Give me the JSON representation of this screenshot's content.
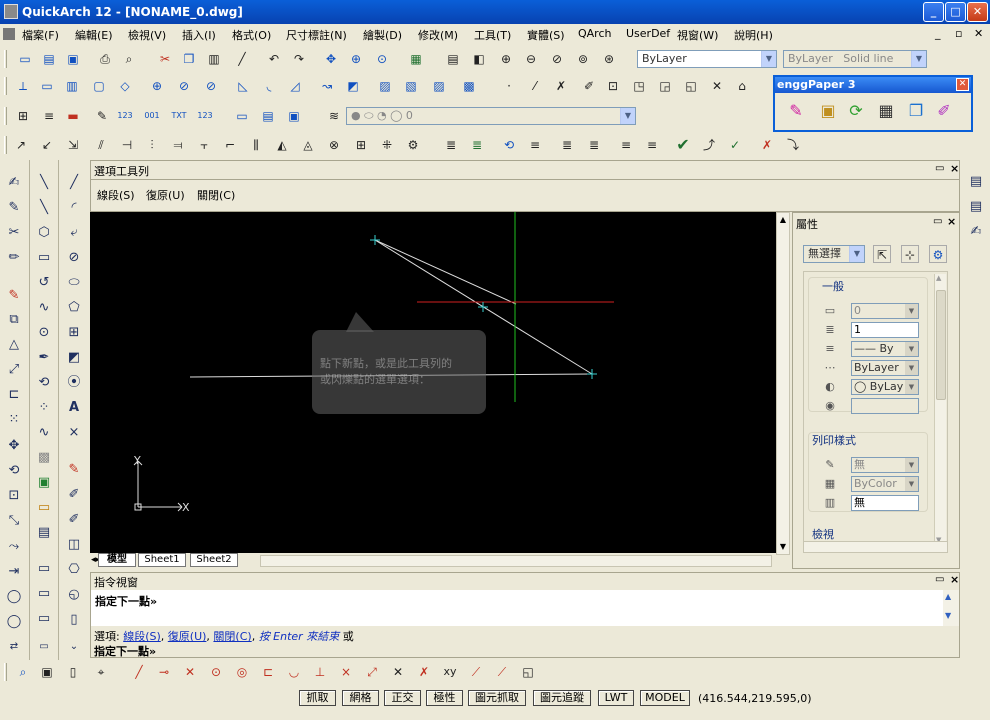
{
  "window": {
    "title": "QuickArch 12 - [NONAME_0.dwg]",
    "min_label": "_",
    "max_label": "□",
    "close_label": "✕",
    "doc_min": "_",
    "doc_max": "▫",
    "doc_close": "✕"
  },
  "menu": [
    "檔案(F)",
    "編輯(E)",
    "檢視(V)",
    "插入(I)",
    "格式(O)",
    "尺寸標註(N)",
    "繪製(D)",
    "修改(M)",
    "工具(T)",
    "實體(S)",
    "QArch",
    "UserDef",
    "視窗(W)",
    "說明(H)"
  ],
  "toolbar": {
    "layer_color": "ByLayer",
    "linetype": "ByLayer",
    "linetype_desc": "Solid line",
    "layer_value": "0"
  },
  "engg_panel": {
    "title": "enggPaper 3",
    "close": "✕"
  },
  "option_bar": {
    "title": "選項工具列",
    "items": [
      "線段(S)",
      "復原(U)",
      "關閉(C)"
    ]
  },
  "properties": {
    "title": "屬性",
    "selection": "無選擇",
    "sections": {
      "general": "一般",
      "plot_style": "列印樣式",
      "view": "檢視"
    },
    "general_fields": [
      "0",
      "1",
      "—— By",
      "ByLayer",
      "◯ ByLay",
      ""
    ],
    "plot_fields": [
      "無",
      "ByColor",
      "無"
    ]
  },
  "tabs": [
    "模型",
    "Sheet1",
    "Sheet2"
  ],
  "command": {
    "title": "指令視窗",
    "line1": "指定下一點»",
    "hist_prefix": "選項: ",
    "hist_opt1": "線段(S)",
    "hist_sep1": ", ",
    "hist_opt2": "復原(U)",
    "hist_sep2": ", ",
    "hist_opt3": "關閉(C)",
    "hist_sep3": ", ",
    "hist_enter": "按 Enter 來結束",
    "hist_or": " 或",
    "line3": "指定下一點»"
  },
  "status": {
    "buttons": [
      "抓取",
      "網格",
      "正交",
      "極性",
      "圖元抓取",
      "圖元追蹤",
      "LWT",
      "MODEL"
    ],
    "coords": "(416.544,219.595,0)"
  },
  "tooltip": {
    "line1": "點下新點，或是此工具列的",
    "line2": "或閃爍點的選單選項："
  },
  "canvas": {
    "ucs_x": "X",
    "ucs_y": "Y"
  }
}
